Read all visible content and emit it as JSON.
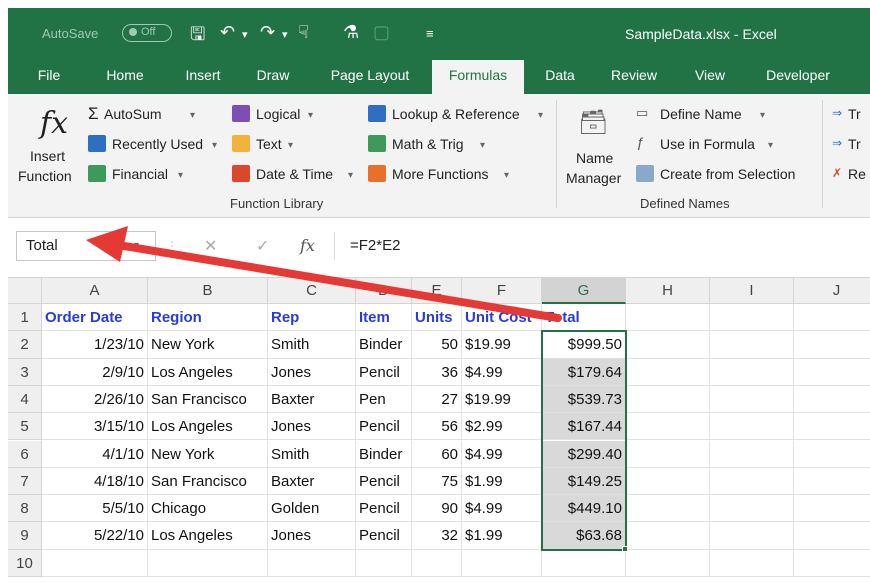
{
  "titlebar": {
    "autosave_label": "AutoSave",
    "autosave_state": "Off",
    "doc_title": "SampleData.xlsx  -  Excel"
  },
  "tabs": [
    "File",
    "Home",
    "Insert",
    "Draw",
    "Page Layout",
    "Formulas",
    "Data",
    "Review",
    "View",
    "Developer"
  ],
  "active_tab": "Formulas",
  "ribbon": {
    "insert_function": {
      "line1": "Insert",
      "line2": "Function",
      "glyph": "fx"
    },
    "library": {
      "autosum": "AutoSum",
      "recently_used": "Recently Used",
      "financial": "Financial",
      "logical": "Logical",
      "text": "Text",
      "date_time": "Date & Time",
      "lookup": "Lookup & Reference",
      "math": "Math & Trig",
      "more": "More Functions",
      "group_label": "Function Library"
    },
    "names": {
      "name_manager_1": "Name",
      "name_manager_2": "Manager",
      "define_name": "Define Name",
      "use_in_formula": "Use in Formula",
      "create_from_selection": "Create from Selection",
      "group_label": "Defined Names"
    },
    "audit": {
      "trace_prec": "Tr",
      "trace_dep": "Tr",
      "remove": "Re"
    }
  },
  "formula_bar": {
    "name_box": "Total",
    "fx": "fx",
    "formula": "=F2*E2"
  },
  "columns": [
    "A",
    "B",
    "C",
    "D",
    "E",
    "F",
    "G",
    "H",
    "I",
    "J"
  ],
  "rows": [
    [
      "1",
      "Order Date",
      "Region",
      "Rep",
      "Item",
      "Units",
      "Unit Cost",
      "Total"
    ],
    [
      "2",
      "1/23/10",
      "New York",
      "Smith",
      "Binder",
      "50",
      "$19.99",
      "$999.50"
    ],
    [
      "3",
      "2/9/10",
      "Los Angeles",
      "Jones",
      "Pencil",
      "36",
      "$4.99",
      "$179.64"
    ],
    [
      "4",
      "2/26/10",
      "San Francisco",
      "Baxter",
      "Pen",
      "27",
      "$19.99",
      "$539.73"
    ],
    [
      "5",
      "3/15/10",
      "Los Angeles",
      "Jones",
      "Pencil",
      "56",
      "$2.99",
      "$167.44"
    ],
    [
      "6",
      "4/1/10",
      "New York",
      "Smith",
      "Binder",
      "60",
      "$4.99",
      "$299.40"
    ],
    [
      "7",
      "4/18/10",
      "San Francisco",
      "Baxter",
      "Pencil",
      "75",
      "$1.99",
      "$149.25"
    ],
    [
      "8",
      "5/5/10",
      "Chicago",
      "Golden",
      "Pencil",
      "90",
      "$4.99",
      "$449.10"
    ],
    [
      "9",
      "5/22/10",
      "Los Angeles",
      "Jones",
      "Pencil",
      "32",
      "$1.99",
      "$63.68"
    ],
    [
      "10",
      "",
      "",
      "",
      "",
      "",
      "",
      ""
    ]
  ],
  "colors": {
    "accent": "#217346",
    "header_text": "#2a3bd6",
    "arrow": "#e53935"
  }
}
